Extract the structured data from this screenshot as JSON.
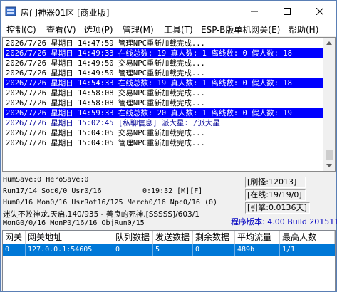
{
  "window": {
    "title": "房门神器01区 [商业版]",
    "minimize_icon": "minimize-icon",
    "maximize_icon": "maximize-icon",
    "close_icon": "close-icon"
  },
  "menu": [
    "控制(C)",
    "查看(V)",
    "选项(P)",
    "管理(M)",
    "工具(T)",
    "ESP-B版单机网关(E)",
    "帮助(H)"
  ],
  "log": [
    {
      "text": "2026/7/26 星期日 14:47:59 管理NPC重新加载完成...",
      "style": "normal"
    },
    {
      "text": "2026/7/26 星期日 14:49:33 在线总数: 19 真人数: 1 离线数: 0 假人数: 18",
      "style": "highlight"
    },
    {
      "text": "2026/7/26 星期日 14:49:50 交易NPC重新加载完成...",
      "style": "normal"
    },
    {
      "text": "2026/7/26 星期日 14:49:50 管理NPC重新加载完成...",
      "style": "normal"
    },
    {
      "text": "2026/7/26 星期日 14:54:33 在线总数: 19 真人数: 1 离线数: 0 假人数: 18",
      "style": "highlight"
    },
    {
      "text": "2026/7/26 星期日 14:58:08 交易NPC重新加载完成...",
      "style": "normal"
    },
    {
      "text": "2026/7/26 星期日 14:58:08 管理NPC重新加载完成...",
      "style": "normal"
    },
    {
      "text": "2026/7/26 星期日 14:59:33 在线总数: 20 真人数: 1 离线数: 0 假人数: 19",
      "style": "highlight"
    },
    {
      "text": "2026/7/26 星期日 15:02:45 [私聊信息] 派大星: /派大星",
      "style": "blue"
    },
    {
      "text": "2026/7/26 星期日 15:04:05 交易NPC重新加载完成...",
      "style": "normal"
    },
    {
      "text": "2026/7/26 星期日 15:04:05 管理NPC重新加载完成...",
      "style": "normal"
    }
  ],
  "status": {
    "line1": "HumSave:0 HeroSave:0",
    "line2": "Run17/14 Soc0/0 Usr0/16",
    "line2_time": "0:19:32 [M][F]",
    "line3": "Hum0/16 Mon0/16 UsrRot16/125 Merch0/16 Npc0/16 (0)",
    "line4": "迷失不败神龙.天启,140/935 - 善良的死神.[SSSSS]/603/1",
    "line5": "MonG0/0/16 MonP0/16/16 ObjRun0/15",
    "refresh": "[刷怪:12013]",
    "online": "[在线:19/19/0]",
    "engine": "[引擎:0.0136天]",
    "version": "程序版本: 4.00 Build 20151104"
  },
  "table": {
    "headers": [
      "网关",
      "网关地址",
      "队列数据",
      "发送数据",
      "剩余数据",
      "平均流量",
      "最高人数"
    ],
    "rows": [
      [
        "0",
        "127.0.0.1:54605",
        "0",
        "5",
        "0",
        "489b",
        "1/1"
      ]
    ]
  },
  "colors": {
    "highlight": "#0000ff",
    "selected_row": "#0078d7",
    "version_text": "#0000c0"
  }
}
